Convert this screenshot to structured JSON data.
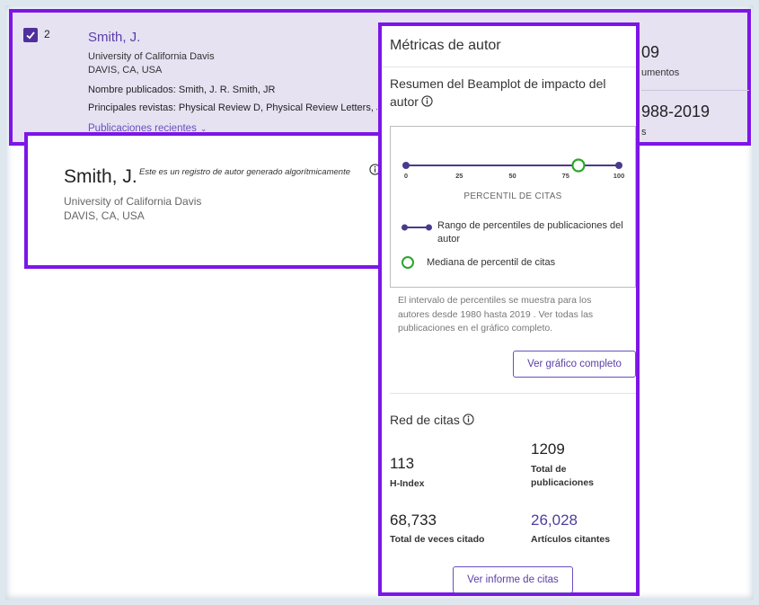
{
  "result_row": {
    "index": "2",
    "name": "Smith, J.",
    "affiliation_line1": "University of California Davis",
    "affiliation_line2": "DAVIS, CA, USA",
    "published_names": "Nombre publicados: Smith, J. R.    Smith, JR",
    "main_journals": "Principales revistas: Physical Review D, Physical Review Letters, Jo",
    "recent_publications_link": "Publicaciones recientes",
    "right_value_1": "09",
    "right_label_1": "umentos",
    "right_value_2": "988-2019",
    "right_label_2": "s"
  },
  "author_card": {
    "name": "Smith, J.",
    "note": "Este es un registro de autor generado algorítmicamente",
    "affiliation_line1": "University of California Davis",
    "affiliation_line2": "DAVIS, CA, USA"
  },
  "metrics_panel": {
    "title": "Métricas de autor",
    "beamplot_title": "Resumen del Beamplot de impacto del autor",
    "beamplot": {
      "ticks": [
        "0",
        "25",
        "50",
        "75",
        "100"
      ],
      "range_start": 0,
      "range_end": 100,
      "median_percentile": 81,
      "axis_label": "PERCENTIL DE CITAS",
      "legend_range": "Rango de percentiles de publicaciones del autor",
      "legend_median": "Mediana de percentil de citas",
      "colors": {
        "range": "#4a3a8c",
        "median": "#2aa52a"
      }
    },
    "note": "El intervalo de percentiles se muestra para los autores desde 1980 hasta 2019 . Ver todas las publicaciones en el gráfico completo.",
    "full_chart_button": "Ver gráfico completo",
    "citation_network_title": "Red de citas",
    "metrics": {
      "h_index_value": "113",
      "h_index_label": "H-Index",
      "total_pubs_value": "1209",
      "total_pubs_label": "Total de publicaciones",
      "times_cited_value": "68,733",
      "times_cited_label": "Total de veces citado",
      "citing_articles_value": "26,028",
      "citing_articles_label": "Artículos citantes"
    },
    "citation_report_button": "Ver informe de citas"
  }
}
